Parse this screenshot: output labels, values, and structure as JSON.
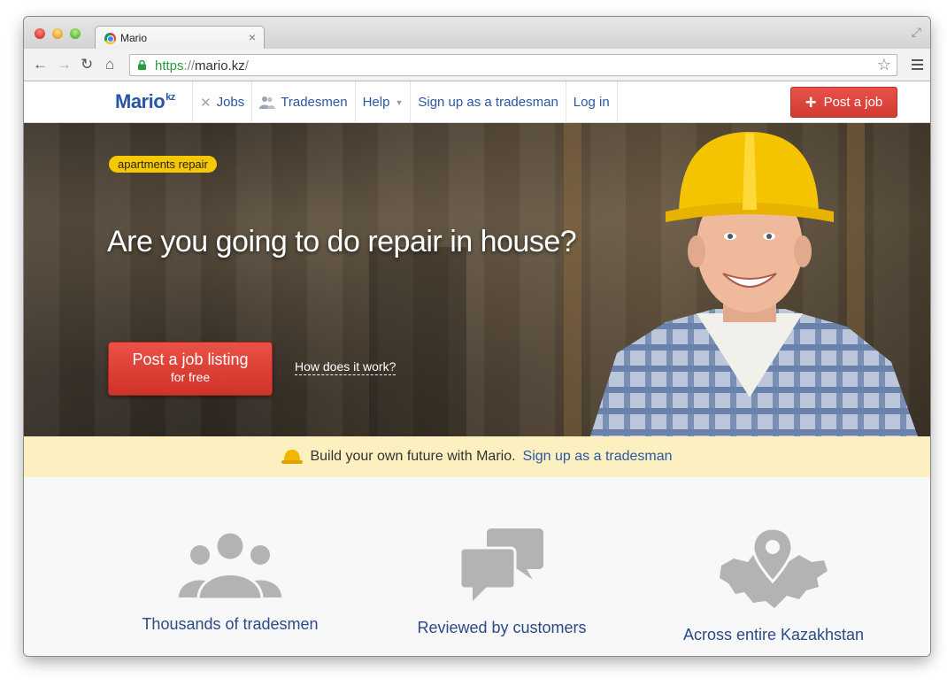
{
  "browser": {
    "tab_title": "Mario",
    "tab_close": "×",
    "url_scheme": "https",
    "url_sep": "://",
    "url_host": "mario.kz",
    "url_trail": "/",
    "icons": [
      "back-icon",
      "forward-icon",
      "reload-icon",
      "home-icon",
      "lock-icon",
      "star-icon",
      "menu-icon",
      "fullscreen-icon"
    ]
  },
  "header": {
    "logo": "Mario",
    "logo_suffix": "kz",
    "nav": {
      "jobs": "Jobs",
      "tradesmen": "Tradesmen",
      "help": "Help",
      "signup": "Sign up as a tradesman",
      "login": "Log in"
    },
    "post_job": "Post a job"
  },
  "hero": {
    "tag": "apartments repair",
    "title": "Are you going to do repair in house?",
    "cta_main": "Post a job listing",
    "cta_sub": "for free",
    "how_link": "How does it work?"
  },
  "promo": {
    "text": "Build your own future with Mario.",
    "link": "Sign up as a tradesman"
  },
  "features": [
    {
      "icon": "people-icon",
      "label": "Thousands of tradesmen"
    },
    {
      "icon": "chat-bubbles-icon",
      "label": "Reviewed by customers"
    },
    {
      "icon": "map-pin-icon",
      "label": "Across entire Kazakhstan"
    }
  ],
  "colors": {
    "brand_blue": "#2b57a5",
    "cta_red": "#d63a30",
    "tag_yellow": "#f5c800",
    "promo_bg": "#fdf0c0",
    "icon_gray": "#b3b3b3"
  }
}
